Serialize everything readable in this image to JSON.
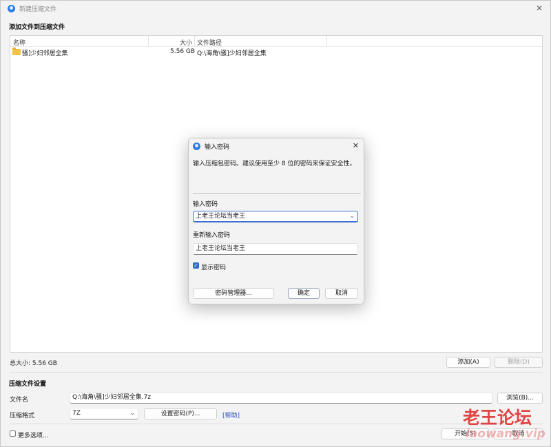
{
  "window": {
    "title": "新建压缩文件",
    "close_icon": "close-icon"
  },
  "files_section": {
    "title": "添加文件到压缩文件"
  },
  "file_table": {
    "columns": [
      "名称",
      "大小",
      "文件路径"
    ],
    "rows": [
      {
        "name": "骚]少妇邻居全集",
        "size": "5.56 GB",
        "path": "Q:\\海角\\骚]少妇邻居全集",
        "icon": "folder-icon"
      }
    ]
  },
  "total_size": "总大小: 5.56 GB",
  "buttons": {
    "add": "添加(A)",
    "remove": "删除(D)",
    "browse": "浏览(B)...",
    "set_password": "设置密码(P)...",
    "start": "开始(S)",
    "cancel": "取消"
  },
  "settings": {
    "title": "压缩文件设置",
    "filename_label": "文件名",
    "filename_value": "Q:\\海角\\骚]少妇邻居全集.7z",
    "format_label": "压缩格式",
    "format_value": "7Z",
    "help_link": "[帮助]",
    "more_options": "更多选项..."
  },
  "dialog": {
    "title": "输入密码",
    "description": "输入压缩包密码。建议使用至少 8 位的密码来保证安全性。",
    "password_label": "输入密码",
    "password_value": "上老王论坛当老王",
    "confirm_label": "重新输入密码",
    "confirm_value": "上老王论坛当老王",
    "show_password": "显示密码",
    "show_password_checked": true,
    "manager_button": "密码管理器...",
    "ok_button": "确定",
    "cancel_button": "取消"
  },
  "watermark": {
    "line1": "老王论坛",
    "line2": "laowang.vip"
  },
  "colors": {
    "accent": "#2e6ec7",
    "link": "#2b4fc4",
    "watermark": "#dc1e1e"
  }
}
